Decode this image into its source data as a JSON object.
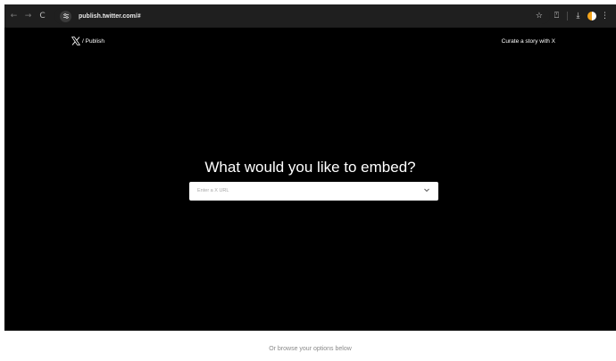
{
  "browser": {
    "back_icon": "←",
    "forward_icon": "→",
    "reload_icon": "C",
    "url": "publish.twitter.com/#",
    "bookmark_icon": "☆",
    "extensions_icon": "⍞",
    "download_icon": "⤓",
    "menu_icon": "⋮"
  },
  "header": {
    "brand_suffix": "/ Publish",
    "curate_link": "Curate a story with X"
  },
  "hero": {
    "headline": "What would you like to embed?",
    "input_placeholder": "Enter a X URL"
  },
  "footer": {
    "browse_text": "Or browse your options below"
  }
}
